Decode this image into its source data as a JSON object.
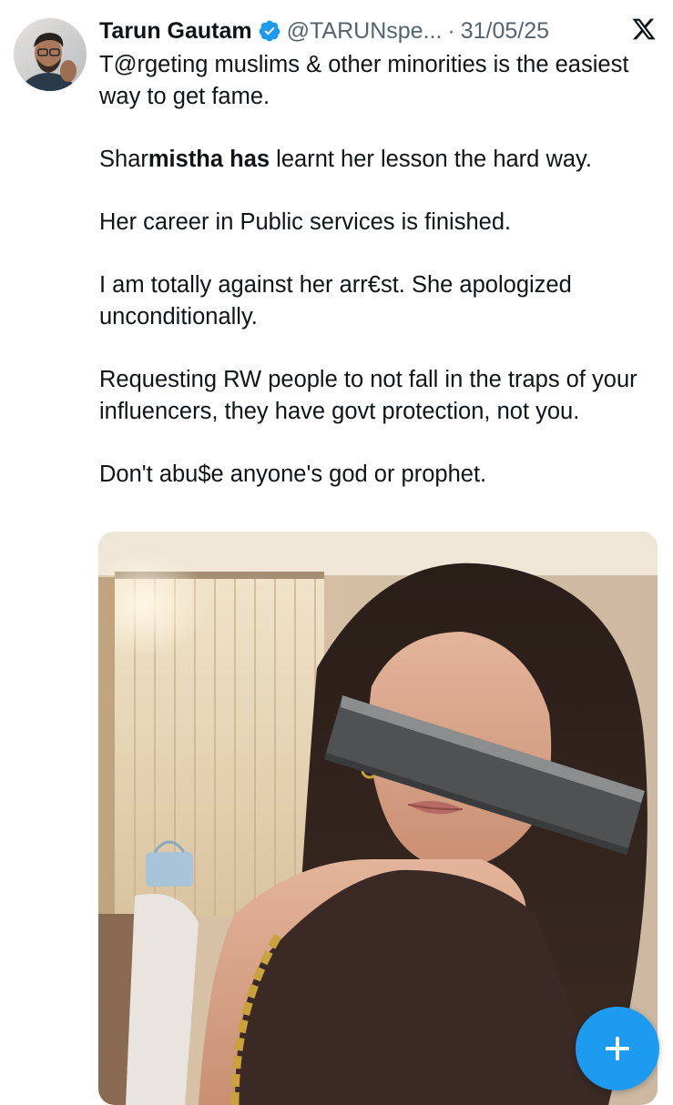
{
  "tweet": {
    "author_name": "Tarun Gautam",
    "handle": "@TARUNspe...",
    "separator": "·",
    "date": "31/05/25",
    "verified_icon": "verified-badge-icon",
    "platform_icon": "x-logo-icon",
    "paragraphs": [
      [
        "T@rgeting muslims & other minorities is the easiest way to get fame."
      ],
      [
        "Shar",
        "mistha has",
        " learnt her lesson the hard way."
      ],
      [
        "Her career in Public services is finished."
      ],
      [
        "I am totally against her arr€st. She apologized unconditionally."
      ],
      [
        "Requesting RW people to not fall in the traps of your influencers, they have govt protection, not you."
      ],
      [
        "Don't abu$e anyone's god or prophet."
      ]
    ],
    "p1": "T@rgeting muslims & other minorities is the easiest way to get fame.",
    "p2_a": "Shar",
    "p2_bold": "mistha has",
    "p2_b": " learnt her lesson the hard way.",
    "p3": "Her career in Public services is finished.",
    "p4": "I am totally against her arr€st. She apologized unconditionally.",
    "p5": "Requesting RW people to not fall in the traps of your influencers, they have govt protection, not you.",
    "p6": "Don't abu$e anyone's god or prophet."
  },
  "compose_button": {
    "icon": "plus-icon"
  },
  "colors": {
    "text": "#0f1419",
    "secondary": "#536471",
    "accent": "#1d9bf0"
  }
}
